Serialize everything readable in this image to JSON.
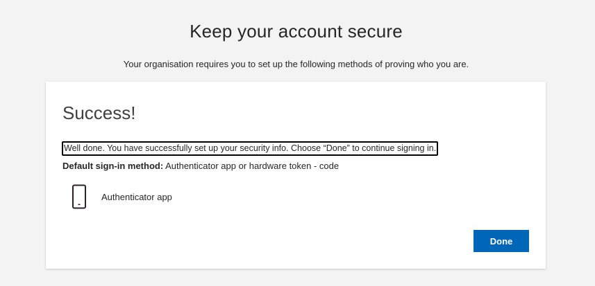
{
  "header": {
    "title": "Keep your account secure",
    "subtitle": "Your organisation requires you to set up the following methods of proving who you are."
  },
  "card": {
    "heading": "Success!",
    "message": "Well done. You have successfully set up your security info. Choose “Done” to continue signing in.",
    "default_method_label": "Default sign-in method:",
    "default_method_value": "Authenticator app or hardware token - code",
    "methods": [
      {
        "name": "Authenticator app",
        "icon": "phone-icon"
      }
    ],
    "done_label": "Done"
  },
  "colors": {
    "accent": "#0067b8",
    "background": "#f3f3f3",
    "card": "#ffffff",
    "icon": "#2e1f2b"
  }
}
